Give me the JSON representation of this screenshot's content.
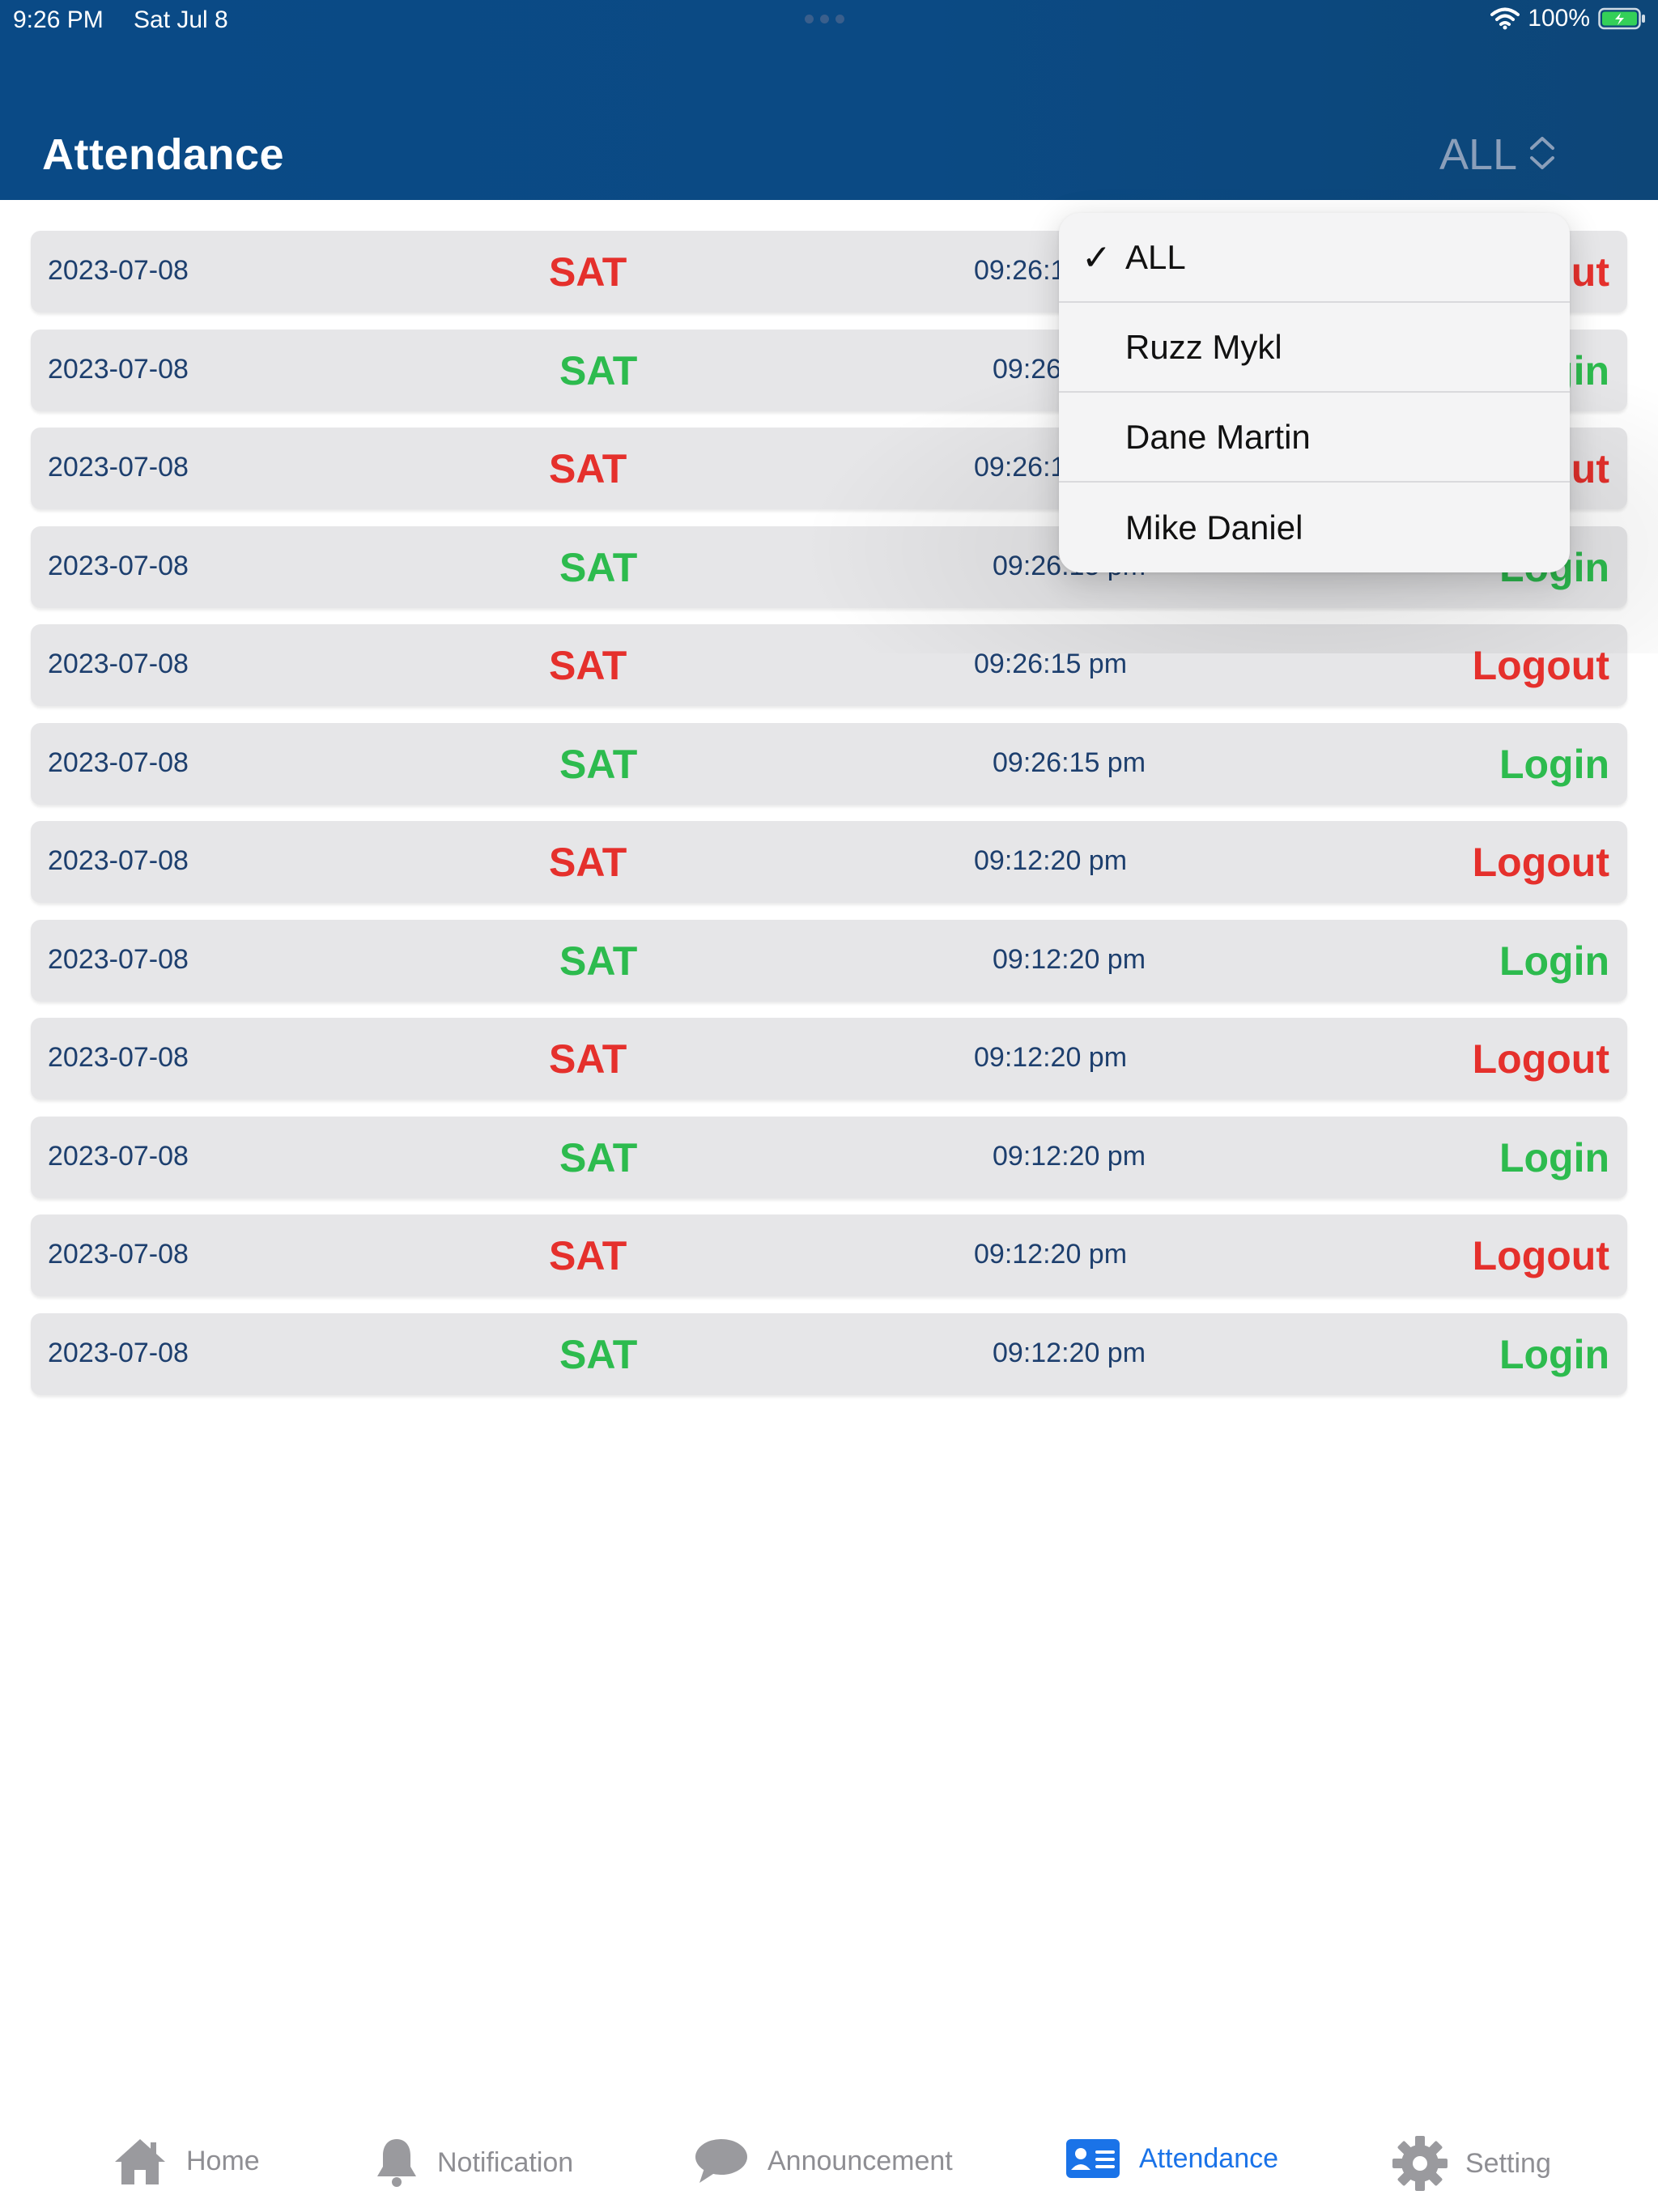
{
  "status_bar": {
    "time": "9:26 PM",
    "date": "Sat Jul 8",
    "battery": "100%"
  },
  "header": {
    "title": "Attendance",
    "filter_value": "ALL"
  },
  "dropdown": {
    "options": [
      {
        "label": "ALL",
        "selected": true
      },
      {
        "label": "Ruzz Mykl",
        "selected": false
      },
      {
        "label": "Dane Martin",
        "selected": false
      },
      {
        "label": "Mike Daniel",
        "selected": false
      }
    ]
  },
  "records": [
    {
      "date": "2023-07-08",
      "day": "SAT",
      "time": "09:26:15 pm",
      "type": "Logout"
    },
    {
      "date": "2023-07-08",
      "day": "SAT",
      "time": "09:26:15 pm",
      "type": "Login"
    },
    {
      "date": "2023-07-08",
      "day": "SAT",
      "time": "09:26:15 pm",
      "type": "Logout"
    },
    {
      "date": "2023-07-08",
      "day": "SAT",
      "time": "09:26:15 pm",
      "type": "Login"
    },
    {
      "date": "2023-07-08",
      "day": "SAT",
      "time": "09:26:15 pm",
      "type": "Logout"
    },
    {
      "date": "2023-07-08",
      "day": "SAT",
      "time": "09:26:15 pm",
      "type": "Login"
    },
    {
      "date": "2023-07-08",
      "day": "SAT",
      "time": "09:12:20 pm",
      "type": "Logout"
    },
    {
      "date": "2023-07-08",
      "day": "SAT",
      "time": "09:12:20 pm",
      "type": "Login"
    },
    {
      "date": "2023-07-08",
      "day": "SAT",
      "time": "09:12:20 pm",
      "type": "Logout"
    },
    {
      "date": "2023-07-08",
      "day": "SAT",
      "time": "09:12:20 pm",
      "type": "Login"
    },
    {
      "date": "2023-07-08",
      "day": "SAT",
      "time": "09:12:20 pm",
      "type": "Logout"
    },
    {
      "date": "2023-07-08",
      "day": "SAT",
      "time": "09:12:20 pm",
      "type": "Login"
    }
  ],
  "tabs": [
    {
      "label": "Home",
      "icon": "home-icon",
      "active": false
    },
    {
      "label": "Notification",
      "icon": "bell-icon",
      "active": false
    },
    {
      "label": "Announcement",
      "icon": "speech-bubble-icon",
      "active": false
    },
    {
      "label": "Attendance",
      "icon": "id-card-icon",
      "active": true
    },
    {
      "label": "Setting",
      "icon": "gear-icon",
      "active": false
    }
  ],
  "colors": {
    "header_bg": "#0b4a84",
    "logout": "#e5302c",
    "login": "#2dbb4e",
    "active_tab": "#1a73e8",
    "inactive_tab": "#8e8e93"
  }
}
